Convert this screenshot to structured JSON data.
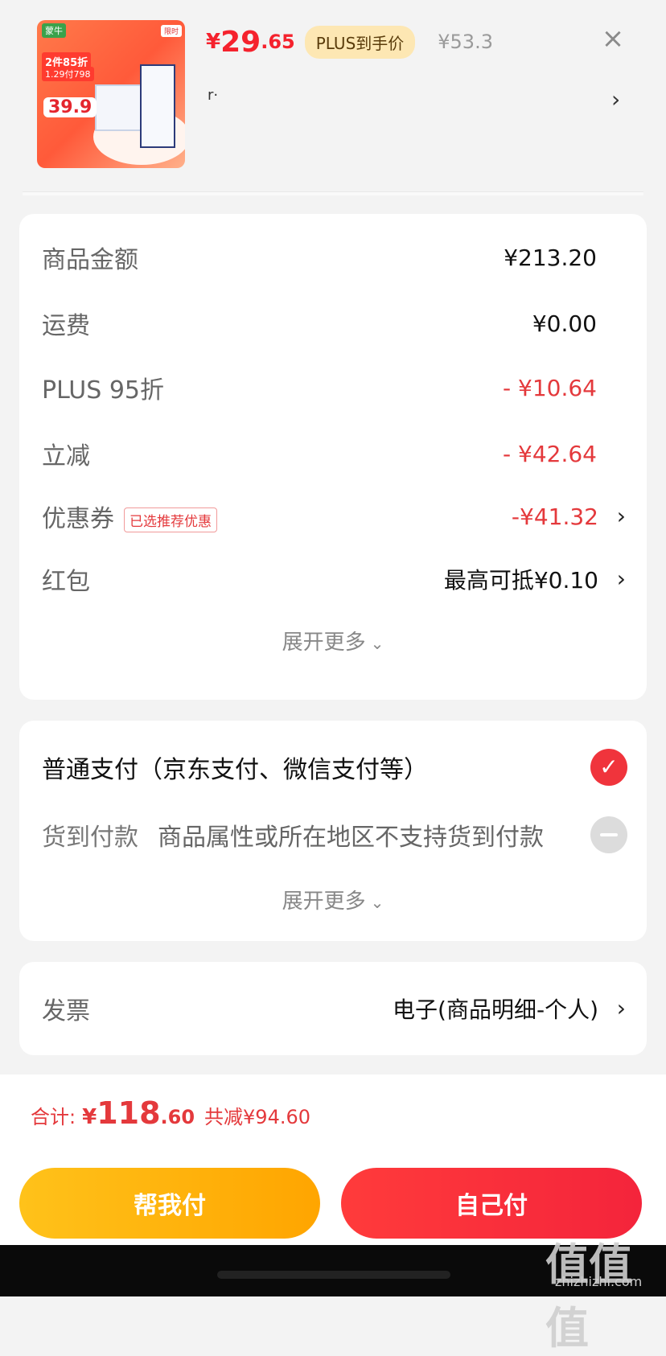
{
  "product": {
    "thumbnail_brand": "蒙牛",
    "thumbnail_promo": "2件85折",
    "thumbnail_promo2": "1.29付798",
    "thumbnail_price": "39.9",
    "price_currency": "¥",
    "price_int": "29",
    "price_dec": ".65",
    "plus_badge": "PLUS到手价",
    "original_price": "¥53.3",
    "subtitle": "r·",
    "close_icon": "×",
    "chevron": "›"
  },
  "summary": {
    "rows": [
      {
        "label": "商品金额",
        "value": "¥213.20"
      },
      {
        "label": "运费",
        "value": "¥0.00"
      },
      {
        "label": "PLUS 95折",
        "value": "- ¥10.64"
      },
      {
        "label": "立减",
        "value": "- ¥42.64"
      },
      {
        "label": "优惠券",
        "tag": "已选推荐优惠",
        "value": "-¥41.32"
      },
      {
        "label": "红包",
        "value": "最高可抵¥0.10"
      }
    ],
    "expand": "展开更多"
  },
  "payment": {
    "normal": "普通支付（京东支付、微信支付等）",
    "cod_label": "货到付款",
    "cod_note": "商品属性或所在地区不支持货到付款",
    "expand": "展开更多"
  },
  "invoice": {
    "label": "发票",
    "value": "电子(商品明细-个人)"
  },
  "total": {
    "label": "合计:",
    "currency": "¥",
    "int": "118",
    "dec": ".60",
    "saved": "共减¥94.60"
  },
  "buttons": {
    "help_pay": "帮我付",
    "self_pay": "自己付"
  },
  "watermark": {
    "main": "值值值",
    "url": "zhizhizhi.com"
  },
  "colors": {
    "accent_red": "#e4393c",
    "yellow": "#ffb300"
  },
  "icons": {
    "close": "close-icon",
    "chevron": "chevron-right-icon",
    "check": "check-circle-icon",
    "disabled": "minus-circle-icon"
  }
}
